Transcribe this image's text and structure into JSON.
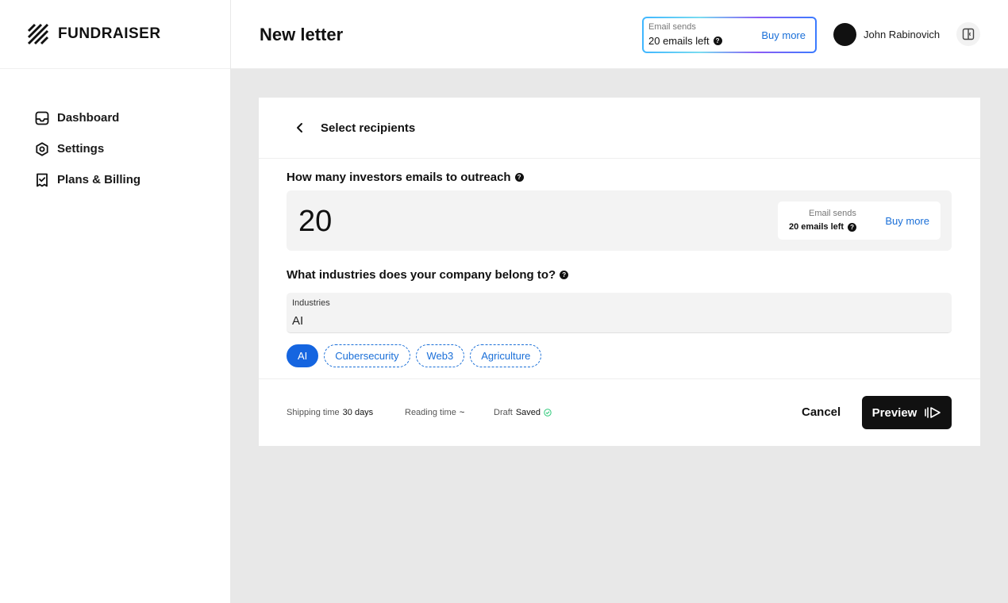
{
  "brand": {
    "name": "FUNDRAISER",
    "logo_icon": "striped-leaf-logo"
  },
  "sidebar": {
    "items": [
      {
        "label": "Dashboard",
        "icon": "inbox-icon"
      },
      {
        "label": "Settings",
        "icon": "hexagon-gear-icon"
      },
      {
        "label": "Plans & Billing",
        "icon": "receipt-check-icon"
      }
    ]
  },
  "header": {
    "title": "New letter",
    "email_sends": {
      "label": "Email sends",
      "value": "20 emails left",
      "buy_label": "Buy more"
    },
    "user": {
      "name": "John Rabinovich"
    },
    "toggle_icon": "panel-toggle-icon"
  },
  "card": {
    "title": "Select recipients",
    "q_count": "How many investors emails to outreach",
    "count_value": "20",
    "mini_sends": {
      "label": "Email sends",
      "value": "20 emails left",
      "buy_label": "Buy more"
    },
    "q_industries": "What industries does your company belong to?",
    "industries_field": {
      "label": "Industries",
      "value": "AI"
    },
    "chips": [
      {
        "label": "AI",
        "active": true
      },
      {
        "label": "Cubersecurity",
        "active": false
      },
      {
        "label": "Web3",
        "active": false
      },
      {
        "label": "Agriculture",
        "active": false
      }
    ],
    "footer": {
      "shipping_label": "Shipping time",
      "shipping_value": "30 days",
      "reading_label": "Reading time",
      "reading_value": "~",
      "draft_label": "Draft",
      "draft_value": "Saved",
      "cancel_label": "Cancel",
      "preview_label": "Preview"
    }
  },
  "colors": {
    "accent": "#1565e0",
    "link": "#1a6fd8",
    "saved": "#2fc97a",
    "dark": "#111111"
  }
}
